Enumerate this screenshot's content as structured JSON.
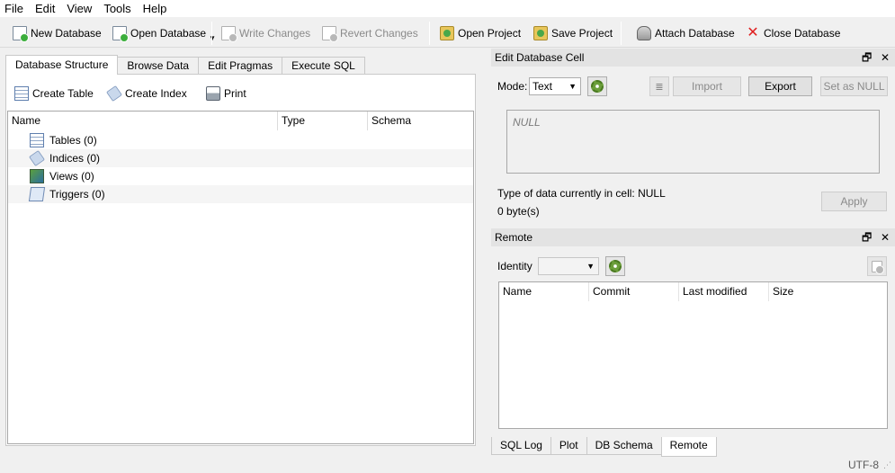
{
  "menu": [
    "File",
    "Edit",
    "View",
    "Tools",
    "Help"
  ],
  "toolbar": {
    "new_db": "New Database",
    "open_db": "Open Database",
    "write": "Write Changes",
    "revert": "Revert Changes",
    "open_proj": "Open Project",
    "save_proj": "Save Project",
    "attach": "Attach Database",
    "close": "Close Database"
  },
  "main_tabs": [
    "Database Structure",
    "Browse Data",
    "Edit Pragmas",
    "Execute SQL"
  ],
  "structure": {
    "create_table": "Create Table",
    "create_index": "Create Index",
    "print": "Print",
    "columns": [
      "Name",
      "Type",
      "Schema"
    ],
    "rows": [
      "Tables (0)",
      "Indices (0)",
      "Views (0)",
      "Triggers (0)"
    ]
  },
  "edit_cell": {
    "title": "Edit Database Cell",
    "mode_label": "Mode:",
    "mode_value": "Text",
    "import": "Import",
    "export": "Export",
    "set_null": "Set as NULL",
    "placeholder": "NULL",
    "type_info": "Type of data currently in cell: NULL",
    "size_info": "0 byte(s)",
    "apply": "Apply"
  },
  "remote": {
    "title": "Remote",
    "identity_label": "Identity",
    "identity_value": "",
    "columns": [
      "Name",
      "Commit",
      "Last modified",
      "Size"
    ]
  },
  "bottom_tabs": [
    "SQL Log",
    "Plot",
    "DB Schema",
    "Remote"
  ],
  "status": {
    "encoding": "UTF-8"
  }
}
